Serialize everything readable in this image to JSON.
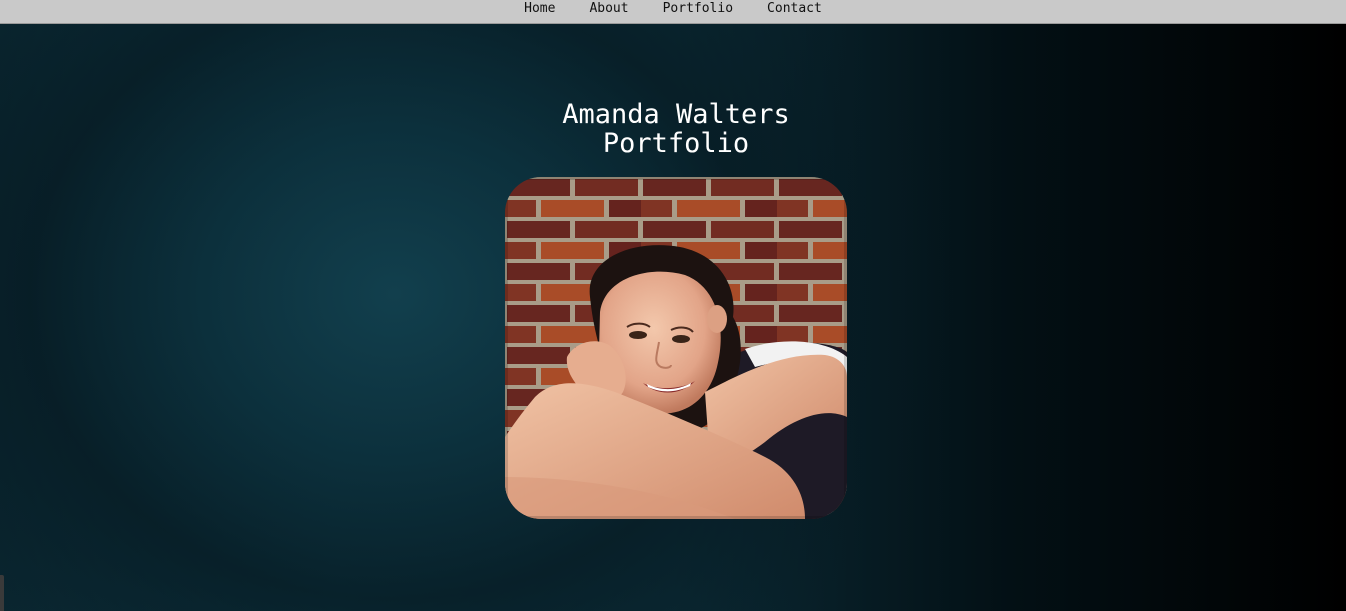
{
  "nav": {
    "items": [
      {
        "label": "Home"
      },
      {
        "label": "About"
      },
      {
        "label": "Portfolio"
      },
      {
        "label": "Contact"
      }
    ]
  },
  "hero": {
    "title_line1": "Amanda Walters",
    "title_line2": "Portfolio"
  },
  "photo": {
    "alt": "Portrait photo of Amanda Walters in front of a brick wall"
  },
  "colors": {
    "nav_bg": "#c9c9c9",
    "title_text": "#ffffff",
    "bg_teal": "#0d3340"
  }
}
